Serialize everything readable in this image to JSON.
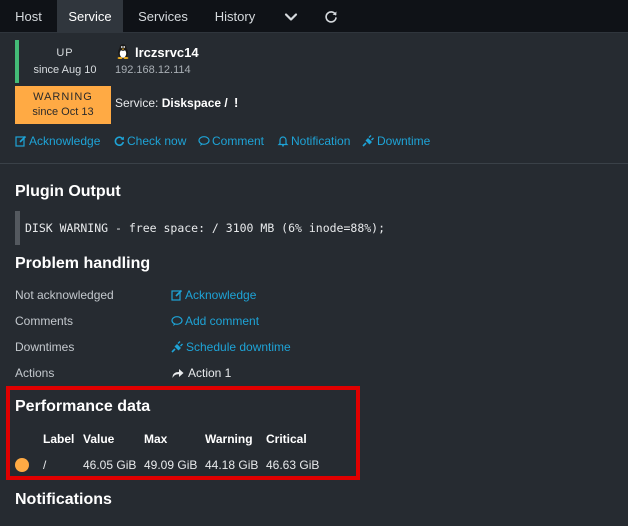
{
  "tabs": [
    {
      "label": "Host"
    },
    {
      "label": "Service",
      "active": true
    },
    {
      "label": "Services"
    },
    {
      "label": "History"
    }
  ],
  "tab_icons": [
    "chevron-down-icon",
    "refresh-icon"
  ],
  "host": {
    "state": "UP",
    "since": "since Aug 10",
    "name": "lrczsrvc14",
    "address": "192.168.12.114",
    "os_icon": "linux-tux-icon"
  },
  "service": {
    "state": "WARNING",
    "since": "since Oct 13",
    "prefix": "Service:",
    "name": "Diskspace /",
    "flag": "!"
  },
  "quick_actions": [
    {
      "label": "Acknowledge",
      "icon": "edit-icon"
    },
    {
      "label": "Check now",
      "icon": "refresh-icon"
    },
    {
      "label": "Comment",
      "icon": "comment-icon"
    },
    {
      "label": "Notification",
      "icon": "bell-icon"
    },
    {
      "label": "Downtime",
      "icon": "plug-icon"
    }
  ],
  "plugin_output": {
    "heading": "Plugin Output",
    "text": "DISK WARNING - free space: / 3100 MB (6% inode=88%);"
  },
  "problem_handling": {
    "heading": "Problem handling",
    "rows": [
      {
        "label": "Not acknowledged",
        "value": "Acknowledge",
        "icon": "edit-icon"
      },
      {
        "label": "Comments",
        "value": "Add comment",
        "icon": "comment-icon"
      },
      {
        "label": "Downtimes",
        "value": "Schedule downtime",
        "icon": "plug-icon"
      },
      {
        "label": "Actions",
        "value": "Action 1",
        "icon": "share-arrow-icon"
      }
    ]
  },
  "performance_data": {
    "heading": "Performance data",
    "columns": [
      "Label",
      "Value",
      "Max",
      "Warning",
      "Critical"
    ],
    "rows": [
      {
        "label": "/",
        "value": "46.05 GiB",
        "max": "49.09 GiB",
        "warning": "44.18 GiB",
        "critical": "46.63 GiB",
        "state_color": "#ffaa44"
      }
    ],
    "highlight_color": "#e00000"
  },
  "notifications": {
    "heading": "Notifications"
  },
  "colors": {
    "background": "#262b31",
    "tabbar": "#0f1217",
    "link": "#1ea3d6",
    "up": "#44bb77",
    "warning": "#ffaa44"
  }
}
